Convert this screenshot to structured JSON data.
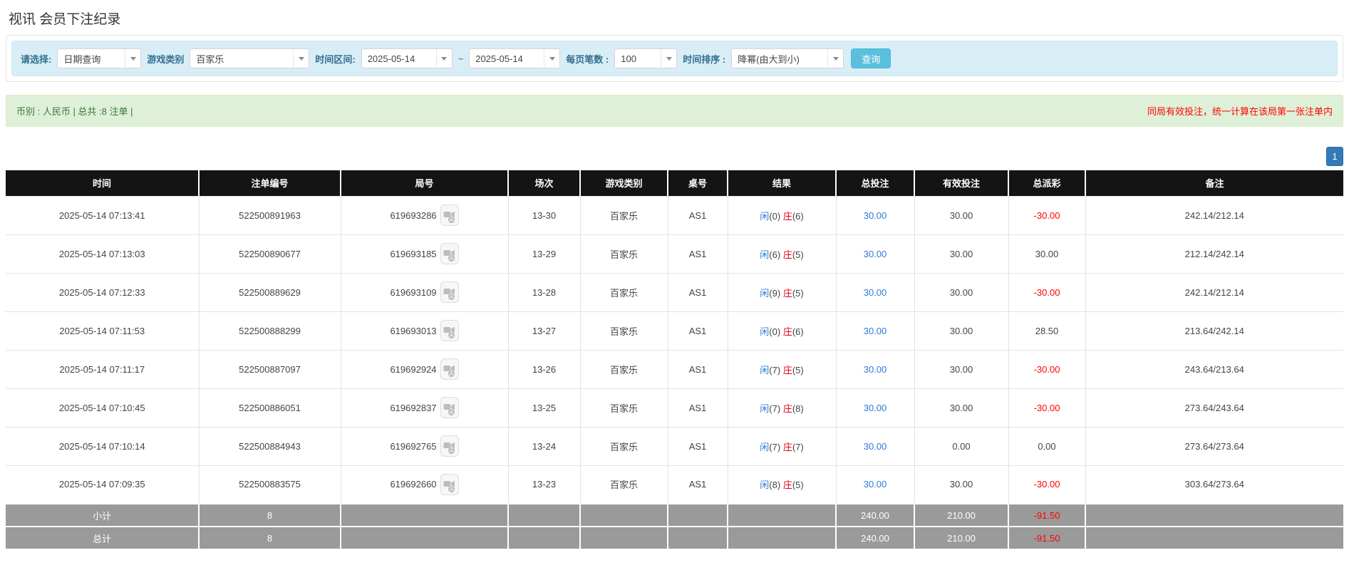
{
  "page": {
    "title": "视讯 会员下注纪录"
  },
  "filters": {
    "select_label": "请选择:",
    "select_value": "日期查询",
    "game_type_label": "游戏类别",
    "game_type_value": "百家乐",
    "date_range_label": "时间区间:",
    "date_from": "2025-05-14",
    "date_separator": "~",
    "date_to": "2025-05-14",
    "page_size_label": "每页笔数 :",
    "page_size_value": "100",
    "sort_label": "时间排序 :",
    "sort_value": "降幂(由大到小)",
    "search_button": "查询"
  },
  "summary": {
    "left": "币别 : 人民币 | 总共 :8 注单 |",
    "right": "同局有效投注，统一计算在该局第一张注单内"
  },
  "pagination": {
    "page": "1"
  },
  "table": {
    "headers": [
      "时间",
      "注单编号",
      "局号",
      "场次",
      "游戏类别",
      "桌号",
      "结果",
      "总投注",
      "有效投注",
      "总派彩",
      "备注"
    ],
    "rows": [
      {
        "time": "2025-05-14 07:13:41",
        "bet_id": "522500891963",
        "round_id": "619693286",
        "session": "13-30",
        "game": "百家乐",
        "table_no": "AS1",
        "player": "闲",
        "player_score": "(0)",
        "banker": "庄",
        "banker_score": "(6)",
        "total_bet": "30.00",
        "valid_bet": "30.00",
        "payout": "-30.00",
        "remark": "242.14/212.14"
      },
      {
        "time": "2025-05-14 07:13:03",
        "bet_id": "522500890677",
        "round_id": "619693185",
        "session": "13-29",
        "game": "百家乐",
        "table_no": "AS1",
        "player": "闲",
        "player_score": "(6)",
        "banker": "庄",
        "banker_score": "(5)",
        "total_bet": "30.00",
        "valid_bet": "30.00",
        "payout": "30.00",
        "remark": "212.14/242.14"
      },
      {
        "time": "2025-05-14 07:12:33",
        "bet_id": "522500889629",
        "round_id": "619693109",
        "session": "13-28",
        "game": "百家乐",
        "table_no": "AS1",
        "player": "闲",
        "player_score": "(9)",
        "banker": "庄",
        "banker_score": "(5)",
        "total_bet": "30.00",
        "valid_bet": "30.00",
        "payout": "-30.00",
        "remark": "242.14/212.14"
      },
      {
        "time": "2025-05-14 07:11:53",
        "bet_id": "522500888299",
        "round_id": "619693013",
        "session": "13-27",
        "game": "百家乐",
        "table_no": "AS1",
        "player": "闲",
        "player_score": "(0)",
        "banker": "庄",
        "banker_score": "(6)",
        "total_bet": "30.00",
        "valid_bet": "30.00",
        "payout": "28.50",
        "remark": "213.64/242.14"
      },
      {
        "time": "2025-05-14 07:11:17",
        "bet_id": "522500887097",
        "round_id": "619692924",
        "session": "13-26",
        "game": "百家乐",
        "table_no": "AS1",
        "player": "闲",
        "player_score": "(7)",
        "banker": "庄",
        "banker_score": "(5)",
        "total_bet": "30.00",
        "valid_bet": "30.00",
        "payout": "-30.00",
        "remark": "243.64/213.64"
      },
      {
        "time": "2025-05-14 07:10:45",
        "bet_id": "522500886051",
        "round_id": "619692837",
        "session": "13-25",
        "game": "百家乐",
        "table_no": "AS1",
        "player": "闲",
        "player_score": "(7)",
        "banker": "庄",
        "banker_score": "(8)",
        "total_bet": "30.00",
        "valid_bet": "30.00",
        "payout": "-30.00",
        "remark": "273.64/243.64"
      },
      {
        "time": "2025-05-14 07:10:14",
        "bet_id": "522500884943",
        "round_id": "619692765",
        "session": "13-24",
        "game": "百家乐",
        "table_no": "AS1",
        "player": "闲",
        "player_score": "(7)",
        "banker": "庄",
        "banker_score": "(7)",
        "total_bet": "30.00",
        "valid_bet": "0.00",
        "payout": "0.00",
        "remark": "273.64/273.64"
      },
      {
        "time": "2025-05-14 07:09:35",
        "bet_id": "522500883575",
        "round_id": "619692660",
        "session": "13-23",
        "game": "百家乐",
        "table_no": "AS1",
        "player": "闲",
        "player_score": "(8)",
        "banker": "庄",
        "banker_score": "(5)",
        "total_bet": "30.00",
        "valid_bet": "30.00",
        "payout": "-30.00",
        "remark": "303.64/273.64"
      }
    ],
    "subtotal": {
      "label": "小计",
      "count": "8",
      "total_bet": "240.00",
      "valid_bet": "210.00",
      "payout": "-91.50"
    },
    "total": {
      "label": "总计",
      "count": "8",
      "total_bet": "240.00",
      "valid_bet": "210.00",
      "payout": "-91.50"
    },
    "colors": {
      "header_bg": "#141414",
      "footer_bg": "#9a9a9a",
      "bet_blue": "#2b7bd6",
      "negative_red": "#ff0000",
      "player_blue": "#2b7bd6",
      "banker_red": "#e60012",
      "accent_info": "#5bc0de",
      "pager_blue": "#337ab7",
      "summary_bg": "#dff0d8",
      "summary_green": "#3c763d",
      "filter_bg": "#d9edf7"
    }
  }
}
